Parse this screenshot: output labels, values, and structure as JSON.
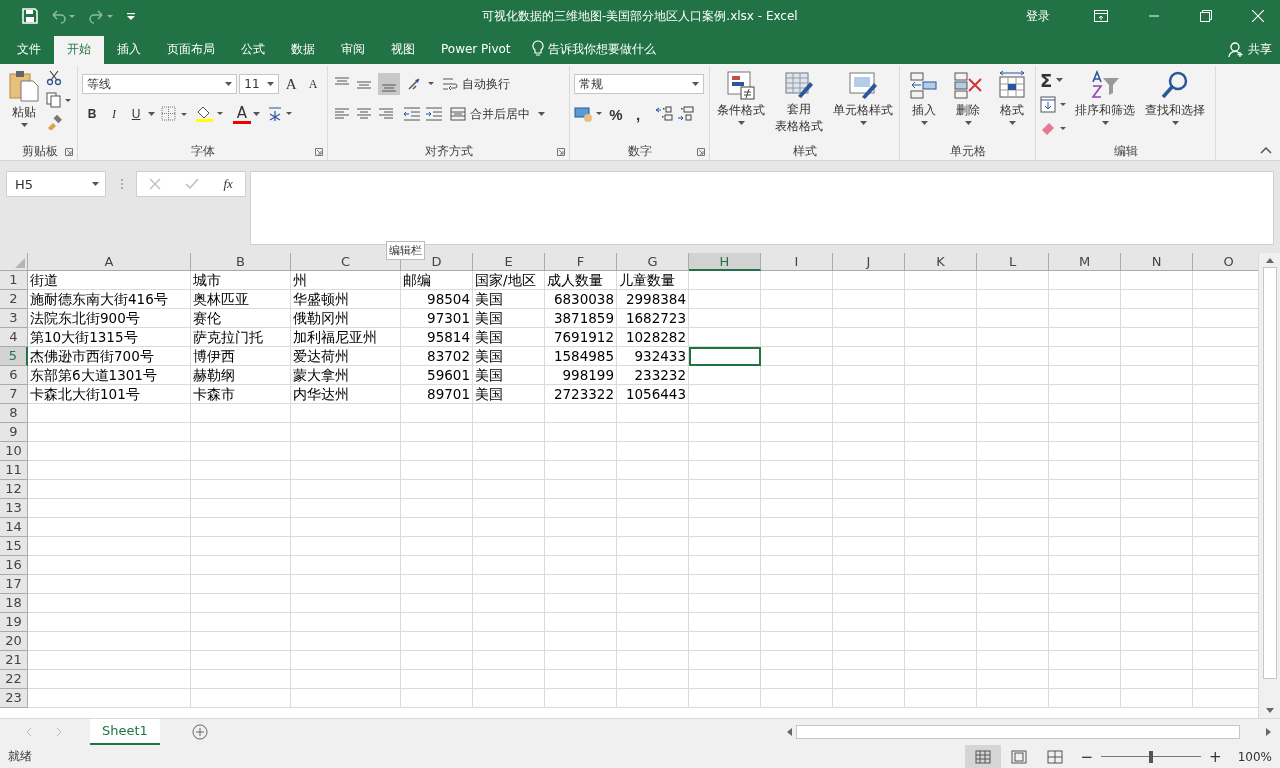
{
  "window": {
    "title": "可视化数据的三维地图-美国部分地区人口案例.xlsx  -  Excel",
    "sign_in": "登录"
  },
  "ribbon_tabs": [
    {
      "label": "文件",
      "selected": false
    },
    {
      "label": "开始",
      "selected": true
    },
    {
      "label": "插入",
      "selected": false
    },
    {
      "label": "页面布局",
      "selected": false
    },
    {
      "label": "公式",
      "selected": false
    },
    {
      "label": "数据",
      "selected": false
    },
    {
      "label": "审阅",
      "selected": false
    },
    {
      "label": "视图",
      "selected": false
    },
    {
      "label": "Power Pivot",
      "selected": false
    }
  ],
  "tell_me": "告诉我你想要做什么",
  "share": "共享",
  "ribbon": {
    "clipboard": {
      "paste": "粘贴",
      "group": "剪贴板"
    },
    "font": {
      "name": "等线",
      "size": "11",
      "grow": "A",
      "shrink": "A",
      "bold": "B",
      "italic": "I",
      "underline": "U",
      "font_color": "A",
      "group": "字体"
    },
    "alignment": {
      "wrap": "自动换行",
      "merge": "合并后居中",
      "group": "对齐方式"
    },
    "number": {
      "format": "常规",
      "percent": "%",
      "comma": ",",
      "group": "数字"
    },
    "styles": {
      "conditional": "条件格式",
      "table_line_1": "套用",
      "table_line_2": "表格格式",
      "cell": "单元格样式",
      "group": "样式"
    },
    "cells": {
      "insert": "插入",
      "delete": "删除",
      "format": "格式",
      "group": "单元格"
    },
    "editing": {
      "sum": "Σ",
      "sort": "排序和筛选",
      "find": "查找和选择",
      "group": "编辑"
    }
  },
  "formula_bar": {
    "name_box": "H5",
    "fx": "fx",
    "tooltip": "编辑栏"
  },
  "sheet": {
    "columns": [
      {
        "label": "A",
        "selected": false
      },
      {
        "label": "B",
        "selected": false
      },
      {
        "label": "C",
        "selected": false
      },
      {
        "label": "D",
        "selected": false
      },
      {
        "label": "E",
        "selected": false
      },
      {
        "label": "F",
        "selected": false
      },
      {
        "label": "G",
        "selected": false
      },
      {
        "label": "H",
        "selected": true
      },
      {
        "label": "I",
        "selected": false
      },
      {
        "label": "J",
        "selected": false
      },
      {
        "label": "K",
        "selected": false
      },
      {
        "label": "L",
        "selected": false
      },
      {
        "label": "M",
        "selected": false
      },
      {
        "label": "N",
        "selected": false
      },
      {
        "label": "O",
        "selected": false
      }
    ],
    "rows": [
      {
        "number": "1",
        "selected": false,
        "cells": [
          "街道",
          "城市",
          "州",
          "邮编",
          "国家/地区",
          "成人数量",
          "儿童数量"
        ]
      },
      {
        "number": "2",
        "selected": false,
        "cells": [
          "施耐德东南大街416号",
          "奥林匹亚",
          "华盛顿州",
          "98504",
          "美国",
          "6830038",
          "2998384"
        ]
      },
      {
        "number": "3",
        "selected": false,
        "cells": [
          "法院东北街900号",
          "赛伦",
          "俄勒冈州",
          "97301",
          "美国",
          "3871859",
          "1682723"
        ]
      },
      {
        "number": "4",
        "selected": false,
        "cells": [
          "第10大街1315号",
          "萨克拉门托",
          "加利福尼亚州",
          "95814",
          "美国",
          "7691912",
          "1028282"
        ]
      },
      {
        "number": "5",
        "selected": true,
        "cells": [
          "杰佛逊市西街700号",
          "博伊西",
          "爱达荷州",
          "83702",
          "美国",
          "1584985",
          "932433"
        ]
      },
      {
        "number": "6",
        "selected": false,
        "cells": [
          "东部第6大道1301号",
          "赫勒纲",
          "蒙大拿州",
          "59601",
          "美国",
          "998199",
          "233232"
        ]
      },
      {
        "number": "7",
        "selected": false,
        "cells": [
          "卡森北大街101号",
          "卡森市",
          "内华达州",
          "89701",
          "美国",
          "2723322",
          "1056443"
        ]
      },
      {
        "number": "8",
        "selected": false
      },
      {
        "number": "9",
        "selected": false
      },
      {
        "number": "10",
        "selected": false
      },
      {
        "number": "11",
        "selected": false
      },
      {
        "number": "12",
        "selected": false
      },
      {
        "number": "13",
        "selected": false
      },
      {
        "number": "14",
        "selected": false
      },
      {
        "number": "15",
        "selected": false
      },
      {
        "number": "16",
        "selected": false
      },
      {
        "number": "17",
        "selected": false
      },
      {
        "number": "18",
        "selected": false
      },
      {
        "number": "19",
        "selected": false
      },
      {
        "number": "20",
        "selected": false
      },
      {
        "number": "21",
        "selected": false
      },
      {
        "number": "22",
        "selected": false
      },
      {
        "number": "23",
        "selected": false
      }
    ]
  },
  "sheet_tabs": [
    {
      "label": "Sheet1",
      "selected": true
    }
  ],
  "status_bar": {
    "text": "就绪",
    "views": [
      {
        "selected": true
      },
      {
        "selected": false
      },
      {
        "selected": false
      }
    ],
    "zoom_out": "−",
    "zoom_slider": {
      "level": 0.5
    },
    "zoom_in": "+",
    "zoom": "100%"
  }
}
